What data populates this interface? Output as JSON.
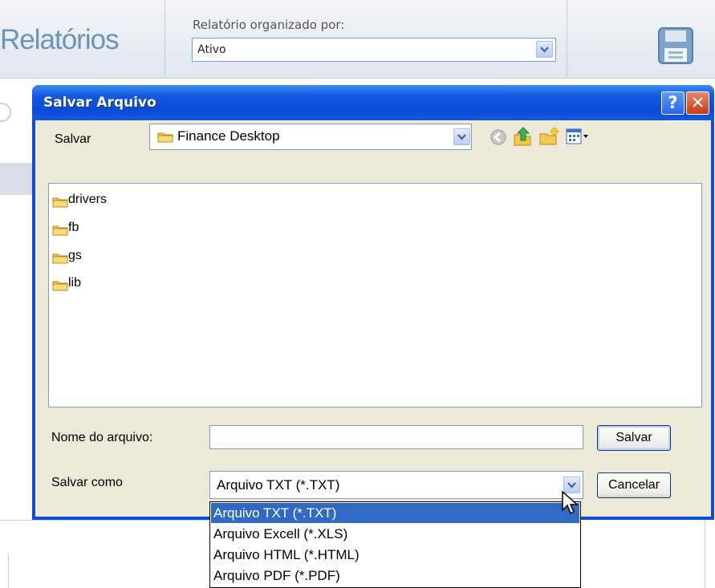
{
  "app": {
    "title": "Relatórios",
    "organize_label": "Relatório organizado por:",
    "organize_value": "Ativo",
    "save_icon": "floppy-disk-icon"
  },
  "dialog": {
    "title": "Salvar Arquivo",
    "help_label": "?",
    "close_label": "✕",
    "save_in_label": "Salvar",
    "location": "Finance Desktop",
    "toolbar_icons": [
      "back-icon",
      "up-folder-icon",
      "new-folder-icon",
      "view-menu-icon"
    ],
    "files": [
      "drivers",
      "fb",
      "gs",
      "lib"
    ],
    "filename_label": "Nome do arquivo:",
    "filename_value": "",
    "save_as_label": "Salvar como",
    "save_as_value": "Arquivo TXT (*.TXT)",
    "save_button": "Salvar",
    "cancel_button": "Cancelar"
  },
  "dropdown": {
    "options": [
      "Arquivo TXT (*.TXT)",
      "Arquivo Excell (*.XLS)",
      "Arquivo HTML (*.HTML)",
      "Arquivo PDF (*.PDF)"
    ],
    "selected_index": 0
  },
  "colors": {
    "title_bar": "#0a4fd6",
    "dialog_face": "#ece9d8",
    "selection": "#316ac5",
    "app_title": "#6f93b8"
  }
}
